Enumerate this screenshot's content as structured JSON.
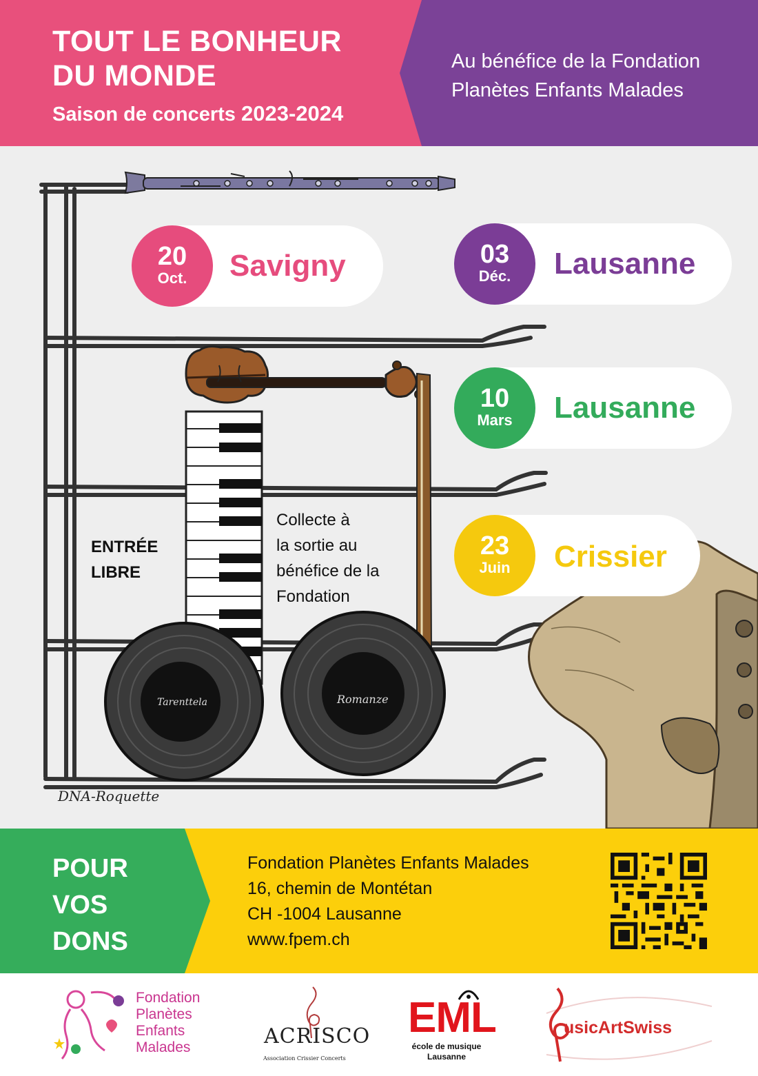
{
  "header": {
    "title_line1": "TOUT LE BONHEUR",
    "title_line2": "DU MONDE",
    "season_text": "Saison de concerts ",
    "season_years": "2023-2024",
    "benefit_line1": "Au bénéfice de la Fondation",
    "benefit_line2": "Planètes Enfants Malades"
  },
  "concerts": [
    {
      "day": "20",
      "month": "Oct.",
      "city": "Savigny",
      "color": "#e64c7d"
    },
    {
      "day": "03",
      "month": "Déc.",
      "city": "Lausanne",
      "color": "#7b3d96"
    },
    {
      "day": "10",
      "month": "Mars",
      "city": "Lausanne",
      "color": "#33ab5b"
    },
    {
      "day": "23",
      "month": "Juin",
      "city": "Crissier",
      "color": "#f5c90e"
    }
  ],
  "middle": {
    "entree_line1": "ENTRÉE",
    "entree_line2": "LIBRE",
    "collecte_line1": "Collecte à",
    "collecte_line2": "la sortie au",
    "collecte_line3": "bénéfice de la",
    "collecte_line4": "Fondation",
    "record1_label": "Tarenttela",
    "record2_label": "Romanze",
    "signature": "DNA-Roquette"
  },
  "donations": {
    "pour_line1": "POUR",
    "pour_line2": "VOS",
    "pour_line3": "DONS",
    "address_line1": "Fondation Planètes Enfants Malades",
    "address_line2": "16, chemin de Montétan",
    "address_line3": "CH -1004 Lausanne",
    "address_line4": "www.fpem.ch"
  },
  "logos": {
    "fpem_line1": "Fondation",
    "fpem_line2": "Planètes",
    "fpem_line3": "Enfants",
    "fpem_line4": "Malades",
    "acrisco_name": "ACRISCO",
    "acrisco_sub": "Association Crissier Concerts",
    "eml_name": "EML",
    "eml_sub1": "école de musique",
    "eml_sub2": "Lausanne",
    "musicartswiss": "usicArtSwiss"
  },
  "colors": {
    "pink": "#e8507c",
    "purple": "#7b4297",
    "green": "#35ad5b",
    "yellow": "#fccf0b"
  }
}
